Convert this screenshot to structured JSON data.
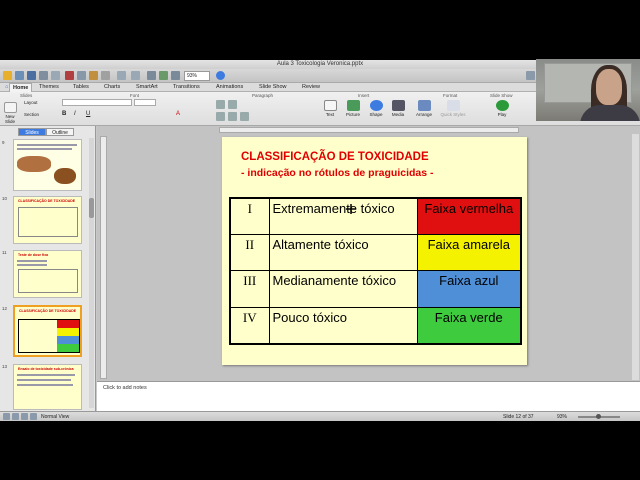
{
  "window": {
    "title": "Aula 3 Toxicologia Veronica.pptx"
  },
  "quickbar": {
    "zoom": "93%"
  },
  "ribbon": {
    "tabs": [
      "Home",
      "Themes",
      "Tables",
      "Charts",
      "SmartArt",
      "Transitions",
      "Animations",
      "Slide Show",
      "Review"
    ],
    "active_tab": "Home",
    "groups": [
      "Slides",
      "Font",
      "Paragraph",
      "Insert",
      "Format",
      "Slide Show"
    ],
    "slides_buttons": {
      "new_slide": "New Slide",
      "layout": "Layout",
      "section": "Section"
    },
    "insert_buttons": [
      "Text",
      "Picture",
      "Shape",
      "Media"
    ],
    "format_buttons": [
      "Arrange",
      "Quick Styles"
    ],
    "slideshow_buttons": [
      "Play"
    ]
  },
  "left_pane": {
    "tabs": [
      "Slides",
      "Outline"
    ],
    "active_tab": "Slides",
    "thumbnails": [
      {
        "number": "9",
        "title": ""
      },
      {
        "number": "10",
        "title": "CLASSIFICAÇÃO DE TOXICIDADE"
      },
      {
        "number": "11",
        "title": "Teste de dose fixa"
      },
      {
        "number": "12",
        "title": "CLASSIFICAÇÃO DE TOXICIDADE"
      },
      {
        "number": "13",
        "title": "Ensaio de toxicidade sub-crônica"
      }
    ]
  },
  "slide": {
    "title": "CLASSIFICAÇÃO DE TOXICIDADE",
    "subtitle": "- indicação no rótulos de praguicidas -",
    "rows": [
      {
        "class": "I",
        "description": "Extremamente tóxico",
        "band": "Faixa vermelha",
        "color": "#e01010"
      },
      {
        "class": "II",
        "description": "Altamente tóxico",
        "band": "Faixa amarela",
        "color": "#f5f200"
      },
      {
        "class": "III",
        "description": "Medianamente tóxico",
        "band": "Faixa azul",
        "color": "#4f8fd8"
      },
      {
        "class": "IV",
        "description": "Pouco tóxico",
        "band": "Faixa verde",
        "color": "#3ecb3e"
      }
    ]
  },
  "notes": {
    "placeholder": "Click to add notes"
  },
  "status": {
    "view": "Normal View",
    "slide_position": "Slide 12 of 37",
    "zoom": "93%"
  }
}
